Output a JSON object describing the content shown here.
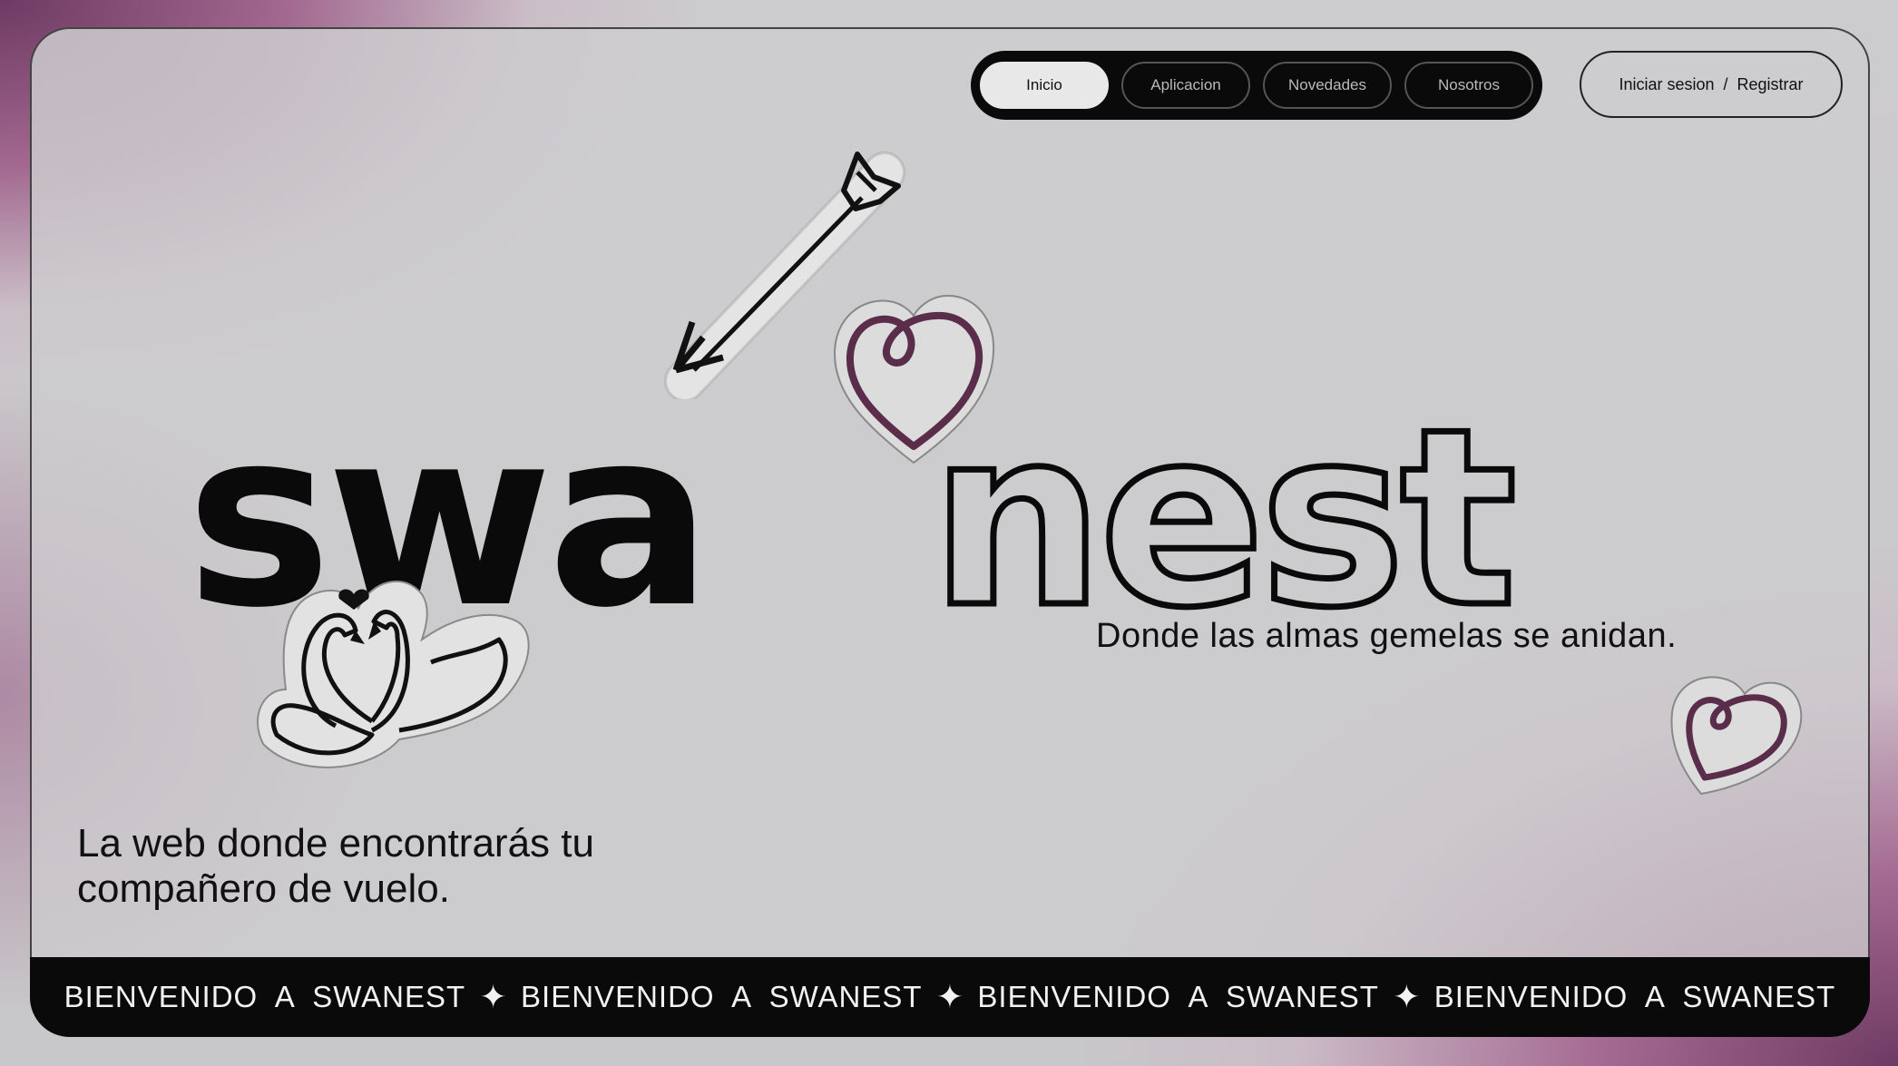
{
  "nav": {
    "items": [
      {
        "label": "Inicio",
        "active": true
      },
      {
        "label": "Aplicacion",
        "active": false
      },
      {
        "label": "Novedades",
        "active": false
      },
      {
        "label": "Nosotros",
        "active": false
      }
    ]
  },
  "auth": {
    "login": "Iniciar sesion",
    "separator": "/",
    "register": "Registrar"
  },
  "hero": {
    "logo_solid": "swa",
    "logo_outline": "nest",
    "tagline": "Donde las almas gemelas se anidan.",
    "subtitle_line1": "La web donde  encontrarás tu",
    "subtitle_line2": "compañero de vuelo."
  },
  "marquee": {
    "items": [
      "BIENVENIDO  A  SWANEST",
      "BIENVENIDO  A  SWANEST",
      "BIENVENIDO  A  SWANEST",
      "BIENVENIDO  A  SWANEST"
    ],
    "separator_icon": "sparkle-icon"
  },
  "colors": {
    "accent": "#5a2e4a",
    "dark": "#0a0a0a",
    "background": "#c9c8ca",
    "gradient": "#8e4f7c"
  },
  "icons": [
    "arrow-sticker-icon",
    "heart-sticker-icon",
    "swans-sticker-icon",
    "sparkle-icon"
  ]
}
